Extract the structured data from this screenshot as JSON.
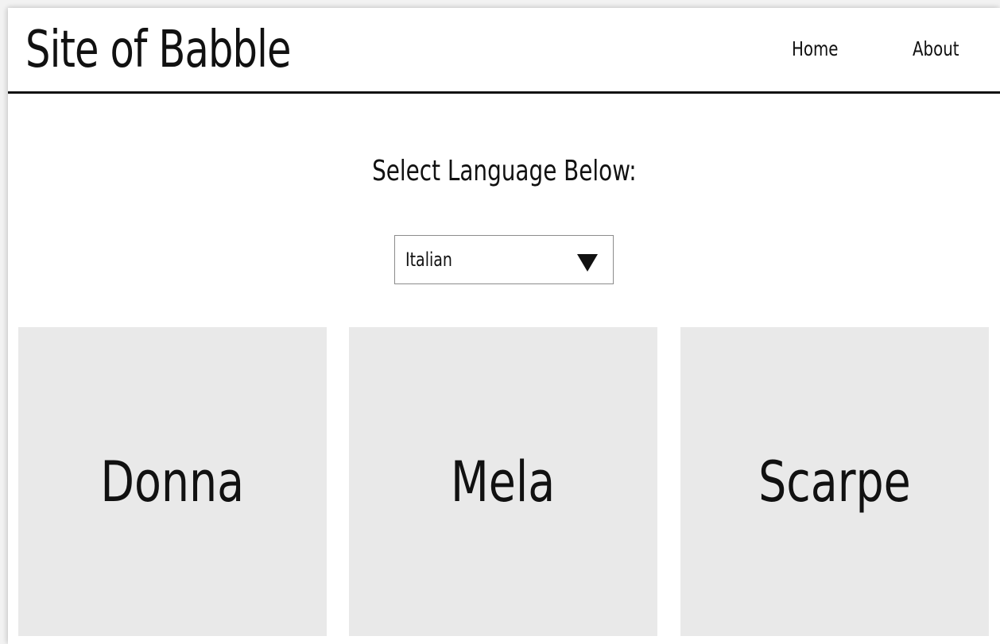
{
  "header": {
    "site_title": "Site of Babble",
    "nav": [
      {
        "label": "Home"
      },
      {
        "label": "About"
      }
    ]
  },
  "main": {
    "prompt": "Select Language Below:",
    "language_select": {
      "selected": "Italian",
      "icon": "triangle-down-icon"
    },
    "word_cards": [
      {
        "word": "Donna"
      },
      {
        "word": "Mela"
      },
      {
        "word": "Scarpe"
      }
    ]
  },
  "colors": {
    "background": "#ffffff",
    "card_background": "#e9e9e9",
    "text": "#111111",
    "header_rule": "#111111",
    "select_border": "#8c8c8c"
  }
}
